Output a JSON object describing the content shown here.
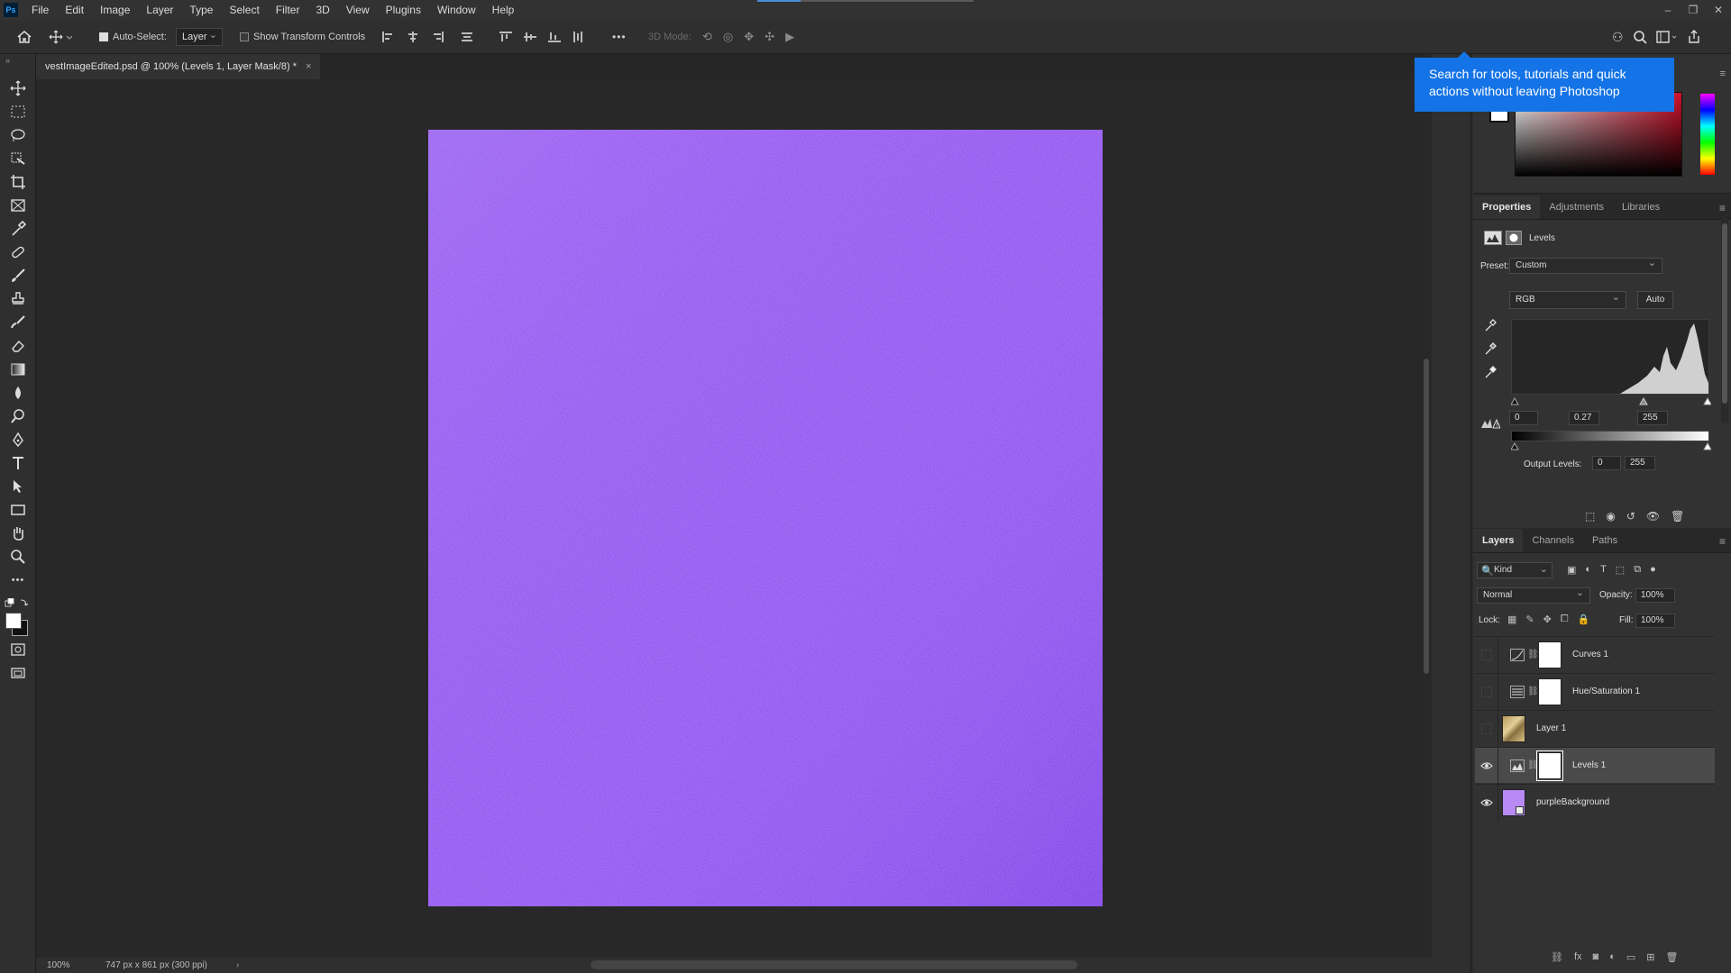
{
  "app": {
    "logo_text": "Ps"
  },
  "menu": [
    "File",
    "Edit",
    "Image",
    "Layer",
    "Type",
    "Select",
    "Filter",
    "3D",
    "View",
    "Plugins",
    "Window",
    "Help"
  ],
  "window_controls": {
    "minimize": "–",
    "restore": "❐",
    "close": "✕"
  },
  "options_bar": {
    "auto_select_label": "Auto-Select:",
    "auto_select_checked": true,
    "auto_select_target": "Layer",
    "show_transform_label": "Show Transform Controls",
    "show_transform_checked": false,
    "mode_3d_label": "3D Mode:",
    "more_label": "•••"
  },
  "document_tab": {
    "title": "vestImageEdited.psd @ 100% (Levels 1, Layer Mask/8) *",
    "close": "×"
  },
  "canvas": {
    "fill_color": "#8b47f0"
  },
  "status": {
    "zoom": "100%",
    "doc_info": "747 px x 861 px (300 ppi)",
    "arrow": "›"
  },
  "tooltip": {
    "text": "Search for tools, tutorials and quick actions without leaving Photoshop"
  },
  "properties_panel": {
    "tabs": [
      "Properties",
      "Adjustments",
      "Libraries"
    ],
    "active_tab": "Properties",
    "adjustment_name": "Levels",
    "preset_label": "Preset:",
    "preset_value": "Custom",
    "channel": "RGB",
    "auto_label": "Auto",
    "input_black": "0",
    "input_gamma": "0.27",
    "input_white": "255",
    "output_label": "Output Levels:",
    "output_black": "0",
    "output_white": "255"
  },
  "layers_panel": {
    "tabs": [
      "Layers",
      "Channels",
      "Paths"
    ],
    "active_tab": "Layers",
    "filter_kind": "Kind",
    "blend_mode": "Normal",
    "opacity_label": "Opacity:",
    "opacity_value": "100%",
    "lock_label": "Lock:",
    "fill_label": "Fill:",
    "fill_value": "100%",
    "layers": [
      {
        "name": "Curves 1",
        "visible": false,
        "type": "curves-adjustment",
        "selected": false
      },
      {
        "name": "Hue/Saturation 1",
        "visible": false,
        "type": "hue-saturation-adjustment",
        "selected": false
      },
      {
        "name": "Layer 1",
        "visible": false,
        "type": "pixel",
        "selected": false
      },
      {
        "name": "Levels 1",
        "visible": true,
        "type": "levels-adjustment",
        "selected": true
      },
      {
        "name": "purpleBackground",
        "visible": true,
        "type": "smart-object",
        "selected": false
      }
    ]
  },
  "colors": {
    "accent": "#1473e6",
    "canvas_purple": "#8b47f0",
    "panel_bg": "#323232"
  }
}
